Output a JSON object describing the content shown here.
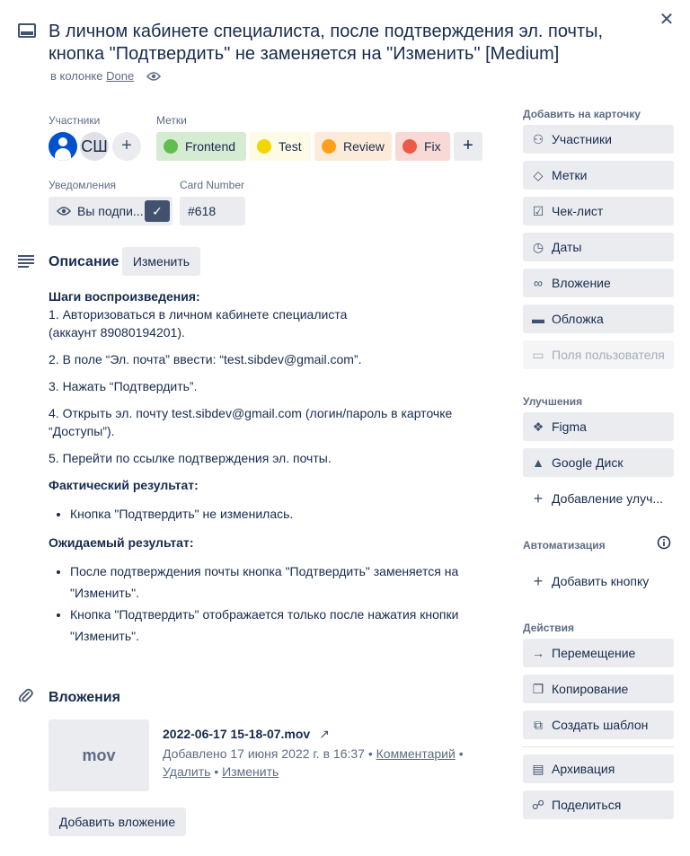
{
  "header": {
    "title": "В личном кабинете специалиста, после подтверждения эл. почты, кнопка \"Подтвердить\" не заменяется на \"Изменить\" [Medium]",
    "in_column_prefix": "в колонке",
    "column_name": "Done"
  },
  "members": {
    "label": "Участники",
    "avatar_initials": "СШ"
  },
  "labels": {
    "label": "Метки",
    "items": [
      {
        "name": "Frontend",
        "bg": "#d6ecd2",
        "dot": "#61bd4f"
      },
      {
        "name": "Test",
        "bg": "#fdfae5",
        "dot": "#f2d600"
      },
      {
        "name": "Review",
        "bg": "#fdebd9",
        "dot": "#ff9f1a"
      },
      {
        "name": "Fix",
        "bg": "#f9d9d6",
        "dot": "#eb5a46"
      }
    ]
  },
  "notifications": {
    "label": "Уведомления",
    "value": "Вы подпи..."
  },
  "card_number": {
    "label": "Card Number",
    "value": "#618"
  },
  "description": {
    "heading": "Описание",
    "edit_button": "Изменить",
    "steps_title": "Шаги воспроизведения:",
    "step1_a": "1. Авторизоваться в личном кабинете специалиста",
    "step1_b": "(аккаунт 89080194201).",
    "step2": "2. В поле “Эл. почта” ввести: “test.sibdev@gmail.com”.",
    "step3": "3. Нажать “Подтвердить”.",
    "step4": "4. Открыть эл. почту test.sibdev@gmail.com (логин/пароль в карточке “Доступы”).",
    "step5": "5. Перейти по ссылке подтверждения эл. почты.",
    "actual_title": "Фактический результат:",
    "actual_items": [
      "Кнопка \"Подтвердить\" не изменилась."
    ],
    "expected_title": "Ожидаемый результат:",
    "expected_items": [
      "После подтверждения почты кнопка \"Подтвердить\" заменяется на \"Изменить\".",
      "Кнопка \"Подтвердить\" отображается только после нажатия кнопки \"Изменить\"."
    ]
  },
  "attachments": {
    "heading": "Вложения",
    "thumb_text": "mov",
    "file_name": "2022-06-17 15-18-07.mov",
    "added_text": "Добавлено 17 июня 2022 г. в 16:37",
    "comment_link": "Комментарий",
    "delete_link": "Удалить",
    "edit_link": "Изменить",
    "add_button": "Добавить вложение"
  },
  "sidebar": {
    "add_heading": "Добавить на карточку",
    "add_items": [
      {
        "label": "Участники",
        "icon": "person-icon"
      },
      {
        "label": "Метки",
        "icon": "tag-icon"
      },
      {
        "label": "Чек-лист",
        "icon": "checklist-icon"
      },
      {
        "label": "Даты",
        "icon": "clock-icon"
      },
      {
        "label": "Вложение",
        "icon": "paperclip-icon"
      },
      {
        "label": "Обложка",
        "icon": "cover-icon"
      },
      {
        "label": "Поля пользователя",
        "icon": "custom-fields-icon"
      }
    ],
    "powerups_heading": "Улучшения",
    "powerups": [
      {
        "label": "Figma",
        "icon": "figma-icon"
      },
      {
        "label": "Google Диск",
        "icon": "google-drive-icon"
      },
      {
        "label": "Добавление улуч...",
        "icon": "plus-icon"
      }
    ],
    "automation_heading": "Автоматизация",
    "automation_items": [
      {
        "label": "Добавить кнопку",
        "icon": "plus-icon"
      }
    ],
    "actions_heading": "Действия",
    "actions": [
      {
        "label": "Перемещение",
        "icon": "arrow-right-icon"
      },
      {
        "label": "Копирование",
        "icon": "copy-icon"
      },
      {
        "label": "Создать шаблон",
        "icon": "template-icon"
      },
      {
        "label": "Архивация",
        "icon": "archive-icon"
      },
      {
        "label": "Поделиться",
        "icon": "share-icon"
      }
    ]
  }
}
